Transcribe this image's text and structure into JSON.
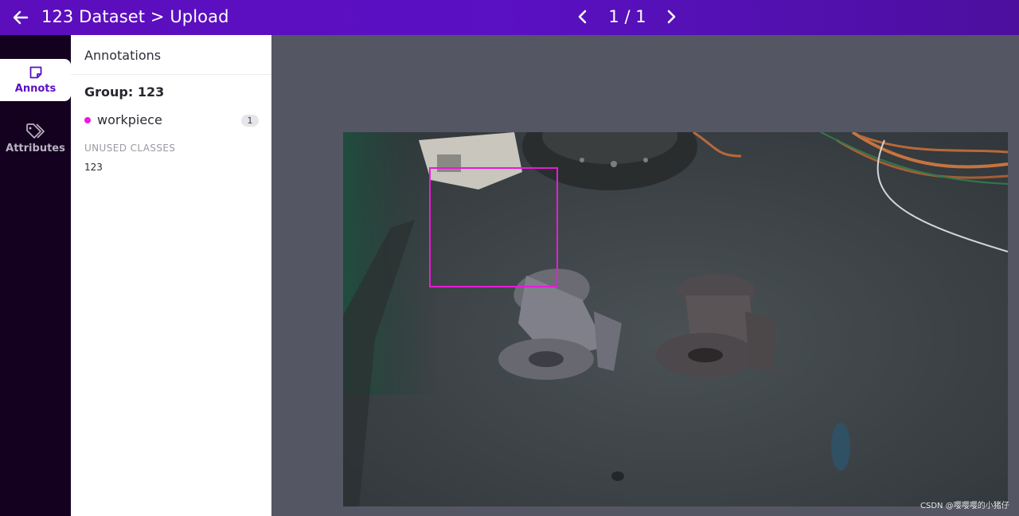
{
  "header": {
    "title": "123 Dataset > Upload",
    "pager": "1 / 1"
  },
  "rail": {
    "tabs": [
      {
        "label": "Annots",
        "icon": "sticky-note-icon",
        "active": true
      },
      {
        "label": "Attributes",
        "icon": "tags-icon",
        "active": false
      }
    ]
  },
  "panel": {
    "title": "Annotations",
    "group": "Group: 123",
    "classes": [
      {
        "name": "workpiece",
        "count": "1",
        "color": "#f018e0"
      }
    ],
    "unused_title": "UNUSED CLASSES",
    "unused": [
      "123"
    ]
  },
  "annotation": {
    "label": "workpiece",
    "color": "#e81ad8"
  },
  "watermark": "CSDN @嘤嘤嘤的小猪仔",
  "colors": {
    "accent": "#5a10c3",
    "rail_bg": "#14001f",
    "canvas_bg": "#545663"
  }
}
